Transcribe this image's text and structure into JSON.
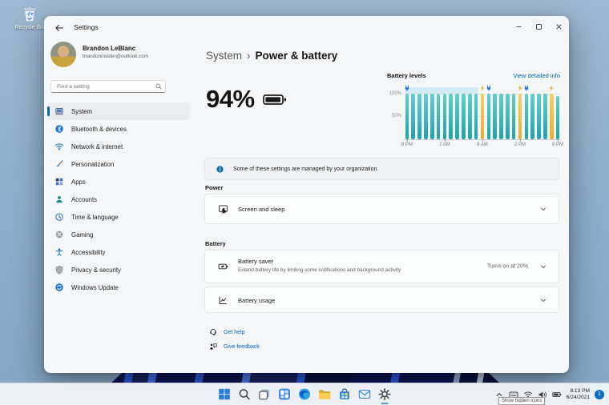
{
  "desktop": {
    "recycle_bin_label": "Recycle Bin"
  },
  "window": {
    "titlebar": {
      "title": "Settings",
      "controls": [
        "minimize",
        "maximize",
        "close"
      ]
    },
    "sidebar": {
      "user": {
        "name": "Brandon LeBlanc",
        "email": "brandoninsider@outlook.com"
      },
      "search_placeholder": "Find a setting",
      "items": [
        {
          "label": "System",
          "icon": "system-icon",
          "selected": true
        },
        {
          "label": "Bluetooth & devices",
          "icon": "bluetooth-icon"
        },
        {
          "label": "Network & internet",
          "icon": "network-icon"
        },
        {
          "label": "Personalization",
          "icon": "personalization-icon"
        },
        {
          "label": "Apps",
          "icon": "apps-icon"
        },
        {
          "label": "Accounts",
          "icon": "accounts-icon"
        },
        {
          "label": "Time & language",
          "icon": "time-language-icon"
        },
        {
          "label": "Gaming",
          "icon": "gaming-icon"
        },
        {
          "label": "Accessibility",
          "icon": "accessibility-icon"
        },
        {
          "label": "Privacy & security",
          "icon": "privacy-security-icon"
        },
        {
          "label": "Windows Update",
          "icon": "windows-update-icon"
        }
      ]
    },
    "content": {
      "breadcrumb": {
        "parent": "System",
        "separator": "›",
        "current": "Power & battery"
      },
      "battery_percent": "94%",
      "banner": {
        "text": "Some of these settings are managed by your organization."
      },
      "power_section": {
        "label": "Power",
        "card": {
          "title": "Screen and sleep"
        }
      },
      "battery_section": {
        "label": "Battery",
        "saver": {
          "title": "Battery saver",
          "subtitle": "Extend battery life by limiting some notifications and background activity",
          "value": "Turns on at 20%"
        },
        "usage": {
          "title": "Battery usage"
        }
      },
      "links": [
        {
          "label": "Get help",
          "icon": "get-help-icon"
        },
        {
          "label": "Give feedback",
          "icon": "give-feedback-icon"
        }
      ]
    }
  },
  "chart_data": {
    "type": "bar",
    "title": "Battery levels",
    "link": "View detailed info",
    "y_tick_labels": [
      "100%",
      "50%"
    ],
    "x_tick_labels": [
      "8 PM",
      "2 AM",
      "8 AM",
      "2 PM",
      "8 PM"
    ],
    "x_tick_bars": [
      0,
      6,
      12,
      18,
      24
    ],
    "ylim": [
      0,
      100
    ],
    "values": [
      100,
      100,
      100,
      100,
      100,
      100,
      100,
      100,
      100,
      100,
      100,
      100,
      100,
      100,
      100,
      100,
      100,
      100,
      100,
      100,
      100,
      100,
      100,
      100,
      94
    ],
    "charging_bars": [
      12,
      18,
      23
    ],
    "markers": [
      {
        "bar": 0,
        "type": "plug"
      },
      {
        "bar": 12,
        "type": "bolt"
      },
      {
        "bar": 13,
        "type": "plug"
      },
      {
        "bar": 18,
        "type": "bolt"
      },
      {
        "bar": 19,
        "type": "plug"
      },
      {
        "bar": 23,
        "type": "bolt"
      }
    ],
    "plugged_band": {
      "from_bar": 0,
      "to_bar": 11
    },
    "colors": {
      "bar": "#3fc0ba",
      "charging": "#f2c14d",
      "band": "#d5eaf4",
      "link": "#0067c0"
    }
  },
  "taskbar": {
    "buttons": [
      {
        "name": "start"
      },
      {
        "name": "search"
      },
      {
        "name": "task-view"
      },
      {
        "name": "widgets"
      },
      {
        "name": "edge"
      },
      {
        "name": "file-explorer"
      },
      {
        "name": "store"
      },
      {
        "name": "mail"
      },
      {
        "name": "settings",
        "active": true
      }
    ],
    "tray": {
      "icons": [
        "chevron-up",
        "touch-keyboard",
        "wifi",
        "volume",
        "battery-tray"
      ],
      "time": "8:13 PM",
      "date": "6/24/2021",
      "badge": "1",
      "tooltip": "Show hidden icons"
    }
  },
  "colors": {
    "accent": "#0067C0",
    "window_bg": "#f4f6f8",
    "desktop_bg": "#8badc9"
  }
}
